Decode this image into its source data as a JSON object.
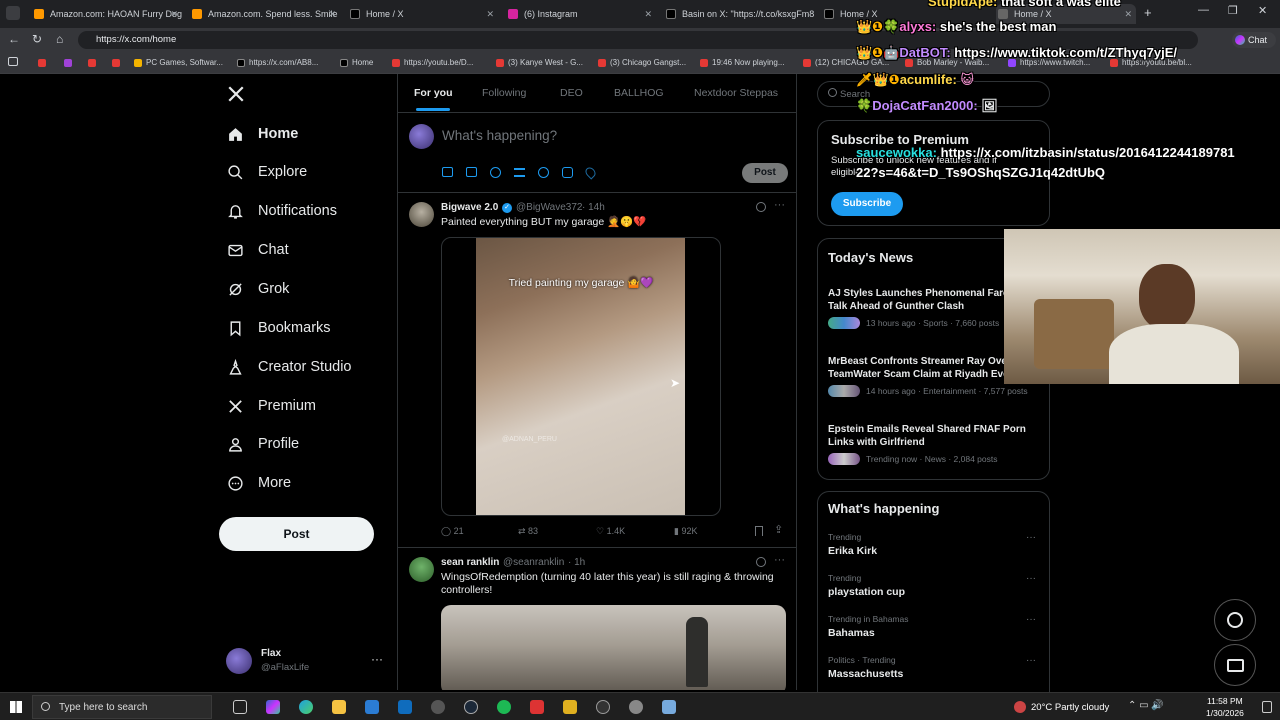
{
  "browser": {
    "tabs": [
      {
        "label": "Amazon.com: HAOAN Furry Dog"
      },
      {
        "label": "Amazon.com. Spend less. Smile m"
      },
      {
        "label": "Home / X"
      },
      {
        "label": "(6) Instagram"
      },
      {
        "label": "Basin on X: \"https://t.co/ksxgFm8"
      },
      {
        "label": "Home / X"
      },
      {
        "label": "Home / X"
      }
    ],
    "url": "https://x.com/home",
    "bookmarks": [
      {
        "label": "PC Games, Softwar..."
      },
      {
        "label": "https://x.com/AB8..."
      },
      {
        "label": "Home"
      },
      {
        "label": "https://youtu.be/D..."
      },
      {
        "label": "(3) Kanye West - G..."
      },
      {
        "label": "(3) Chicago Gangst..."
      },
      {
        "label": "19:46 Now playing..."
      },
      {
        "label": "(12) CHICAGO GA..."
      },
      {
        "label": "Bob Marley - Waib..."
      },
      {
        "label": "https://www.twitch..."
      },
      {
        "label": "https://youtu.be/bl..."
      }
    ],
    "chat_label": "Chat"
  },
  "nav": {
    "items": [
      {
        "label": "Home",
        "icon": "home-icon"
      },
      {
        "label": "Explore",
        "icon": "search-icon"
      },
      {
        "label": "Notifications",
        "icon": "bell-icon"
      },
      {
        "label": "Chat",
        "icon": "mail-icon"
      },
      {
        "label": "Grok",
        "icon": "grok-icon"
      },
      {
        "label": "Bookmarks",
        "icon": "bookmark-icon"
      },
      {
        "label": "Creator Studio",
        "icon": "creator-icon"
      },
      {
        "label": "Premium",
        "icon": "x-icon"
      },
      {
        "label": "Profile",
        "icon": "person-icon"
      },
      {
        "label": "More",
        "icon": "more-icon"
      }
    ],
    "post_label": "Post",
    "account": {
      "name": "Flax",
      "handle": "@aFlaxLife"
    }
  },
  "feed": {
    "tabs": [
      "For you",
      "Following",
      "DEO",
      "BALLHOG",
      "Nextdoor Steppas"
    ],
    "composer": {
      "placeholder": "What's happening?",
      "post_label": "Post"
    },
    "tweets": [
      {
        "name": "Bigwave 2.0",
        "handle": "@BigWave372",
        "time": "· 14h",
        "text": "Painted everything BUT my garage 🤦🤫💔",
        "video_caption": "Tried painting my garage 🤷💜",
        "watermark": "@ADNAN_PERU",
        "replies": "21",
        "reposts": "83",
        "likes": "1.4K",
        "views": "92K"
      },
      {
        "name": "sean ranklin",
        "handle": "@seanranklin",
        "time": "· 1h",
        "text": "WingsOfRedemption (turning 40 later this year) is still raging & throwing controllers!"
      }
    ]
  },
  "sidebar": {
    "search_placeholder": "Search",
    "premium": {
      "title": "Subscribe to Premium",
      "body": "Subscribe to unlock new features and if eligible",
      "button": "Subscribe"
    },
    "news_heading": "Today's News",
    "news": [
      {
        "title": "AJ Styles Launches Phenomenal Fare Tour Talk Ahead of Gunther Clash",
        "meta": "13 hours ago · Sports · 7,660 posts"
      },
      {
        "title": "MrBeast Confronts Streamer Ray Ove TeamWater Scam Claim at Riyadh Eve",
        "meta": "14 hours ago · Entertainment · 7,577 posts"
      },
      {
        "title": "Epstein Emails Reveal Shared FNAF Porn Links with Girlfriend",
        "meta": "Trending now · News · 2,084 posts"
      }
    ],
    "happening_heading": "What's happening",
    "trends": [
      {
        "category": "Trending",
        "name": "Erika Kirk"
      },
      {
        "category": "Trending",
        "name": "playstation cup"
      },
      {
        "category": "Trending in Bahamas",
        "name": "Bahamas"
      },
      {
        "category": "Politics · Trending",
        "name": "Massachusetts"
      }
    ]
  },
  "overlay_chat": [
    {
      "user": "StupidApe:",
      "msg": "that soft a was elite",
      "color": "#ffd84a"
    },
    {
      "user": "alyxs:",
      "msg": "she's the best man",
      "color": "#ff7ad9"
    },
    {
      "user": "DatBOT:",
      "msg": "https://www.tiktok.com/t/ZThyq7yjE/",
      "color": "#c28bff"
    },
    {
      "user": "acumlife:",
      "msg": "",
      "color": "#ffd84a"
    },
    {
      "user": "DojaCatFan2000:",
      "msg": "",
      "color": "#c28bff"
    },
    {
      "user": "saucewokka:",
      "msg": "https://x.com/itzbasin/status/2016412244189781",
      "color": "#27e0e0"
    },
    {
      "user": "",
      "msg": "22?s=46&t=D_Ts9OShqSZGJ1q42dtUbQ",
      "color": "#ffffff"
    }
  ],
  "taskbar": {
    "search_placeholder": "Type here to search",
    "weather": "20°C  Partly cloudy",
    "time": "11:58 PM",
    "date": "1/30/2026"
  }
}
